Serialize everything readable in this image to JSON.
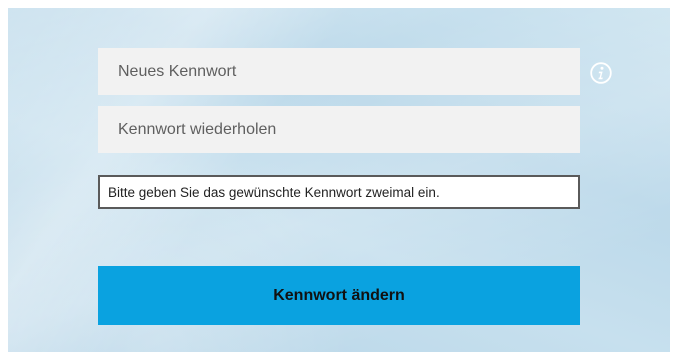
{
  "form": {
    "new_password": {
      "placeholder": "Neues Kennwort",
      "value": ""
    },
    "repeat_password": {
      "placeholder": "Kennwort wiederholen",
      "value": ""
    },
    "info_icon": "info-icon",
    "hint": "Bitte geben Sie das gewünschte Kennwort zweimal ein.",
    "submit_label": "Kennwort ändern"
  },
  "colors": {
    "background": "#c5deed",
    "field_background": "#f2f2f2",
    "button_background": "#0aa2e0",
    "hint_border": "#5a5a5a"
  }
}
